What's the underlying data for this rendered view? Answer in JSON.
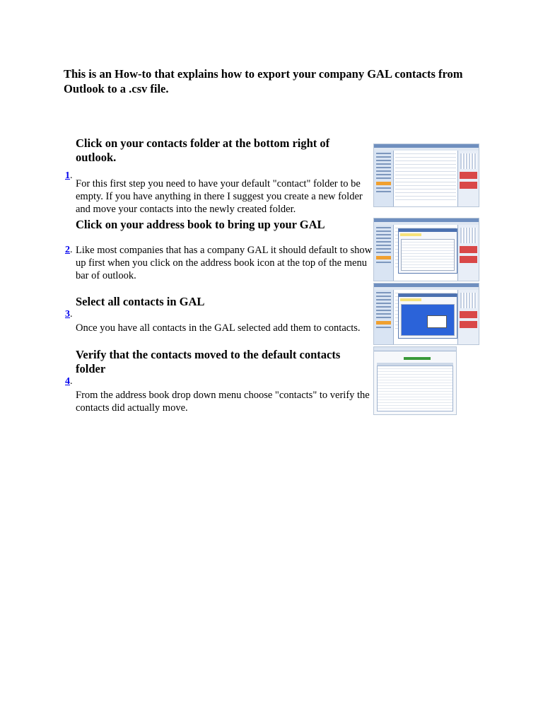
{
  "title": "This is an How-to that explains how to export your company GAL contacts from Outlook to a .csv file.",
  "steps": [
    {
      "number": "1",
      "heading": "Click on your contacts folder at the bottom right of outlook.",
      "body": "For this first step you need to have your default \"contact\" folder to be empty. If you have anything in there I suggest you create a new folder and move your contacts into the newly created folder."
    },
    {
      "number": "2",
      "heading": "Click on your address book to bring up your GAL",
      "body": "Like most companies that has a company GAL it should default to show up first when you click on the address book icon at the top of the menu bar of outlook."
    },
    {
      "number": "3",
      "heading": "Select all contacts in GAL",
      "body": "Once you have all contacts in the GAL selected add them to contacts."
    },
    {
      "number": "4",
      "heading": "Verify that the contacts moved to the default contacts folder",
      "body": "From the address book drop down menu choose \"contacts\" to verify the contacts did actually move."
    }
  ]
}
